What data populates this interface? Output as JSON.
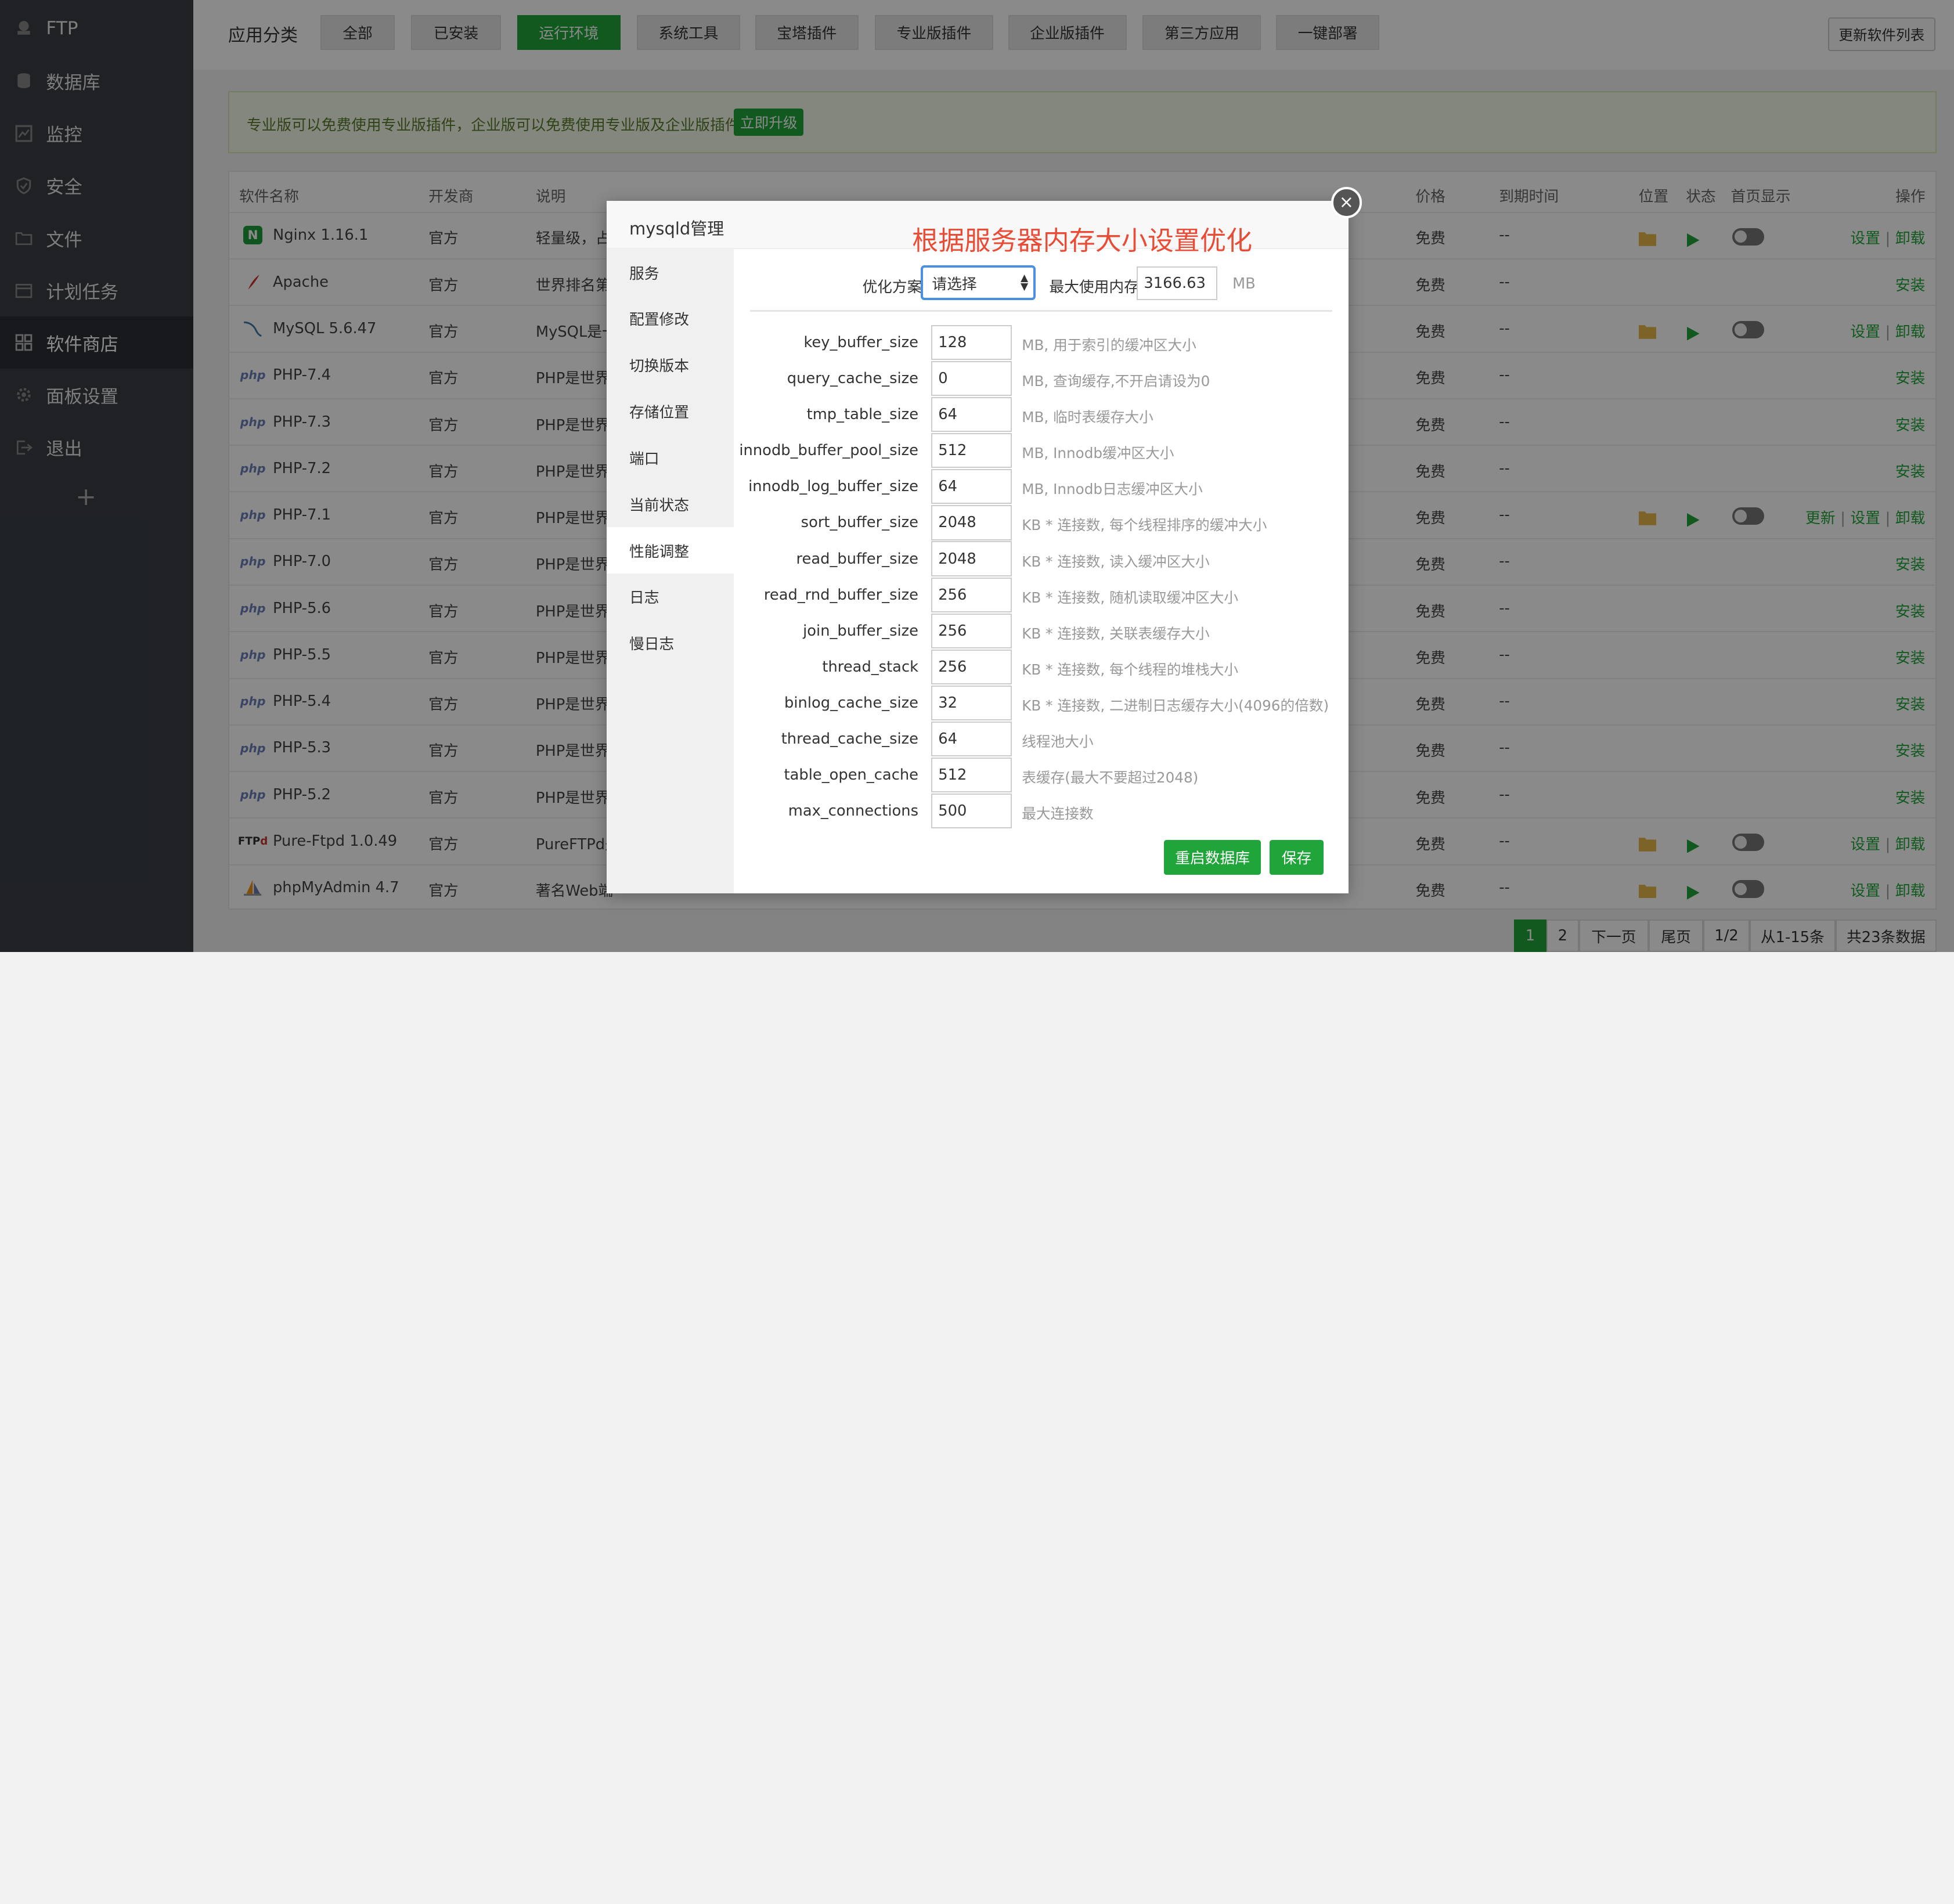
{
  "sidebar": {
    "items": [
      {
        "label": "FTP",
        "icon": "ftp-icon"
      },
      {
        "label": "数据库",
        "icon": "database-icon"
      },
      {
        "label": "监控",
        "icon": "monitor-icon"
      },
      {
        "label": "安全",
        "icon": "shield-icon"
      },
      {
        "label": "文件",
        "icon": "folder-icon"
      },
      {
        "label": "计划任务",
        "icon": "calendar-icon"
      },
      {
        "label": "软件商店",
        "icon": "grid-icon"
      },
      {
        "label": "面板设置",
        "icon": "gear-icon"
      },
      {
        "label": "退出",
        "icon": "logout-icon"
      }
    ],
    "add": "+"
  },
  "topbar": {
    "title": "应用分类",
    "categories": [
      "全部",
      "已安装",
      "运行环境",
      "系统工具",
      "宝塔插件",
      "专业版插件",
      "企业版插件",
      "第三方应用",
      "一键部署"
    ],
    "update_button": "更新软件列表"
  },
  "promo": {
    "text": "专业版可以免费使用专业版插件，企业版可以免费使用专业版及企业版插件 。",
    "button": "立即升级"
  },
  "table": {
    "headers": [
      "软件名称",
      "开发商",
      "说明",
      "价格",
      "到期时间",
      "位置",
      "状态",
      "首页显示",
      "操作"
    ],
    "rows": [
      {
        "name": "Nginx 1.16.1",
        "dev": "官方",
        "desc": "轻量级，占",
        "price": "免费",
        "expire": "--",
        "ops": [
          "设置",
          "卸载"
        ]
      },
      {
        "name": "Apache",
        "dev": "官方",
        "desc": "世界排名第",
        "price": "免费",
        "expire": "--",
        "ops": [
          "安装"
        ]
      },
      {
        "name": "MySQL 5.6.47",
        "dev": "官方",
        "desc": "MySQL是一",
        "price": "免费",
        "expire": "--",
        "ops": [
          "设置",
          "卸载"
        ]
      },
      {
        "name": "PHP-7.4",
        "dev": "官方",
        "desc": "PHP是世界",
        "price": "免费",
        "expire": "--",
        "ops": [
          "安装"
        ]
      },
      {
        "name": "PHP-7.3",
        "dev": "官方",
        "desc": "PHP是世界",
        "price": "免费",
        "expire": "--",
        "ops": [
          "安装"
        ]
      },
      {
        "name": "PHP-7.2",
        "dev": "官方",
        "desc": "PHP是世界",
        "price": "免费",
        "expire": "--",
        "ops": [
          "安装"
        ]
      },
      {
        "name": "PHP-7.1",
        "dev": "官方",
        "desc": "PHP是世界",
        "price": "免费",
        "expire": "--",
        "ops": [
          "更新",
          "设置",
          "卸载"
        ]
      },
      {
        "name": "PHP-7.0",
        "dev": "官方",
        "desc": "PHP是世界",
        "price": "免费",
        "expire": "--",
        "ops": [
          "安装"
        ]
      },
      {
        "name": "PHP-5.6",
        "dev": "官方",
        "desc": "PHP是世界",
        "price": "免费",
        "expire": "--",
        "ops": [
          "安装"
        ]
      },
      {
        "name": "PHP-5.5",
        "dev": "官方",
        "desc": "PHP是世界",
        "price": "免费",
        "expire": "--",
        "ops": [
          "安装"
        ]
      },
      {
        "name": "PHP-5.4",
        "dev": "官方",
        "desc": "PHP是世界",
        "price": "免费",
        "expire": "--",
        "ops": [
          "安装"
        ]
      },
      {
        "name": "PHP-5.3",
        "dev": "官方",
        "desc": "PHP是世界",
        "price": "免费",
        "expire": "--",
        "ops": [
          "安装"
        ]
      },
      {
        "name": "PHP-5.2",
        "dev": "官方",
        "desc": "PHP是世界",
        "price": "免费",
        "expire": "--",
        "ops": [
          "安装"
        ]
      },
      {
        "name": "Pure-Ftpd 1.0.49",
        "dev": "官方",
        "desc": "PureFTPd是",
        "price": "免费",
        "expire": "--",
        "ops": [
          "设置",
          "卸载"
        ]
      },
      {
        "name": "phpMyAdmin 4.7",
        "dev": "官方",
        "desc": "著名Web端",
        "price": "免费",
        "expire": "--",
        "ops": [
          "设置",
          "卸载"
        ]
      }
    ]
  },
  "pagination": {
    "pages": [
      "1",
      "2"
    ],
    "next": "下一页",
    "last": "尾页",
    "page_info": "1/2",
    "range": "从1-15条",
    "total": "共23条数据"
  },
  "modal": {
    "title": "mysqld管理",
    "annotation": "根据服务器内存大小设置优化",
    "tabs": [
      "服务",
      "配置修改",
      "切换版本",
      "存储位置",
      "端口",
      "当前状态",
      "性能调整",
      "日志",
      "慢日志"
    ],
    "active_tab": "性能调整",
    "opt_label": "优化方案",
    "opt_value": "请选择",
    "mem_label": "最大使用内存",
    "mem_value": "3166.63",
    "mem_unit": "MB",
    "params": [
      {
        "name": "key_buffer_size",
        "value": "128",
        "desc": "MB, 用于索引的缓冲区大小"
      },
      {
        "name": "query_cache_size",
        "value": "0",
        "desc": "MB, 查询缓存,不开启请设为0"
      },
      {
        "name": "tmp_table_size",
        "value": "64",
        "desc": "MB, 临时表缓存大小"
      },
      {
        "name": "innodb_buffer_pool_size",
        "value": "512",
        "desc": "MB, Innodb缓冲区大小"
      },
      {
        "name": "innodb_log_buffer_size",
        "value": "64",
        "desc": "MB, Innodb日志缓冲区大小"
      },
      {
        "name": "sort_buffer_size",
        "value": "2048",
        "desc": "KB * 连接数, 每个线程排序的缓冲大小"
      },
      {
        "name": "read_buffer_size",
        "value": "2048",
        "desc": "KB * 连接数, 读入缓冲区大小"
      },
      {
        "name": "read_rnd_buffer_size",
        "value": "256",
        "desc": "KB * 连接数, 随机读取缓冲区大小"
      },
      {
        "name": "join_buffer_size",
        "value": "256",
        "desc": "KB * 连接数, 关联表缓存大小"
      },
      {
        "name": "thread_stack",
        "value": "256",
        "desc": "KB * 连接数, 每个线程的堆栈大小"
      },
      {
        "name": "binlog_cache_size",
        "value": "32",
        "desc": "KB * 连接数, 二进制日志缓存大小(4096的倍数)"
      },
      {
        "name": "thread_cache_size",
        "value": "64",
        "desc": "线程池大小"
      },
      {
        "name": "table_open_cache",
        "value": "512",
        "desc": "表缓存(最大不要超过2048)"
      },
      {
        "name": "max_connections",
        "value": "500",
        "desc": "最大连接数"
      }
    ],
    "restart_button": "重启数据库",
    "save_button": "保存",
    "close": "×"
  },
  "colors": {
    "accent": "#20a53a",
    "sidebar": "#3a3e44",
    "annotation": "#e94b35"
  }
}
